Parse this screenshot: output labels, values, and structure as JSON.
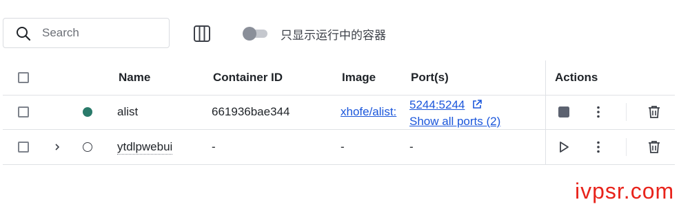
{
  "toolbar": {
    "search_placeholder": "Search",
    "toggle_label": "只显示运行中的容器",
    "toggle_on": false
  },
  "table": {
    "columns": [
      "Name",
      "Container ID",
      "Image",
      "Port(s)",
      "Actions"
    ],
    "rows": [
      {
        "status": "running",
        "status_color": "#2a7a6a",
        "name": "alist",
        "container_id": "661936bae344",
        "image": "xhofe/alist:",
        "port": "5244:5244",
        "show_all_ports": "Show all ports (2)"
      },
      {
        "status": "stopped",
        "name": "ytdlpwebui",
        "container_id": "-",
        "image": "-",
        "port": "-"
      }
    ]
  },
  "colors": {
    "accent_link": "#1a56db",
    "running": "#2a7a6a",
    "watermark": "#e8231b"
  },
  "watermark": "ivpsr.com"
}
